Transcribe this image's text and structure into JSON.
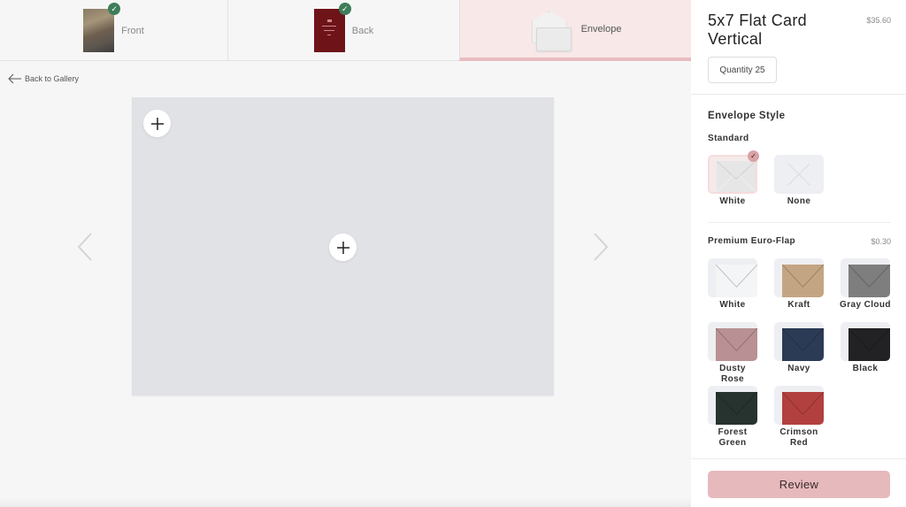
{
  "tabs": [
    {
      "label": "Front",
      "completed": true,
      "active": false
    },
    {
      "label": "Back",
      "completed": true,
      "active": false
    },
    {
      "label": "Envelope",
      "completed": false,
      "active": true
    }
  ],
  "back_link": "Back to Gallery",
  "product": {
    "title": "5x7 Flat Card Vertical",
    "price": "$35.60",
    "quantity_label": "Quantity 25"
  },
  "envelope_style": {
    "title": "Envelope Style",
    "standard": {
      "title": "Standard",
      "options": [
        {
          "name": "White",
          "color": "#e8e8e8",
          "selected": true
        },
        {
          "name": "None",
          "color": "none",
          "selected": false
        }
      ]
    },
    "premium": {
      "title": "Premium Euro-Flap",
      "price": "$0.30",
      "options": [
        {
          "name": "White",
          "color": "#f4f5f7"
        },
        {
          "name": "Kraft",
          "color": "#c4a583"
        },
        {
          "name": "Gray Cloud",
          "color": "#7e7e7e"
        },
        {
          "name": "Dusty Rose",
          "color": "#b99194"
        },
        {
          "name": "Navy",
          "color": "#2c3b55"
        },
        {
          "name": "Black",
          "color": "#222224"
        },
        {
          "name": "Forest Green",
          "name_lines": [
            "Forest",
            "Green"
          ],
          "color": "#27332f"
        },
        {
          "name": "Crimson Red",
          "name_lines": [
            "Crimson",
            "Red"
          ],
          "color": "#b2403f"
        }
      ]
    }
  },
  "review_button": "Review",
  "colors": {
    "accent": "#e6babd",
    "active_tab_bg": "#f8e8e8",
    "check_green": "#3e7d5a"
  }
}
